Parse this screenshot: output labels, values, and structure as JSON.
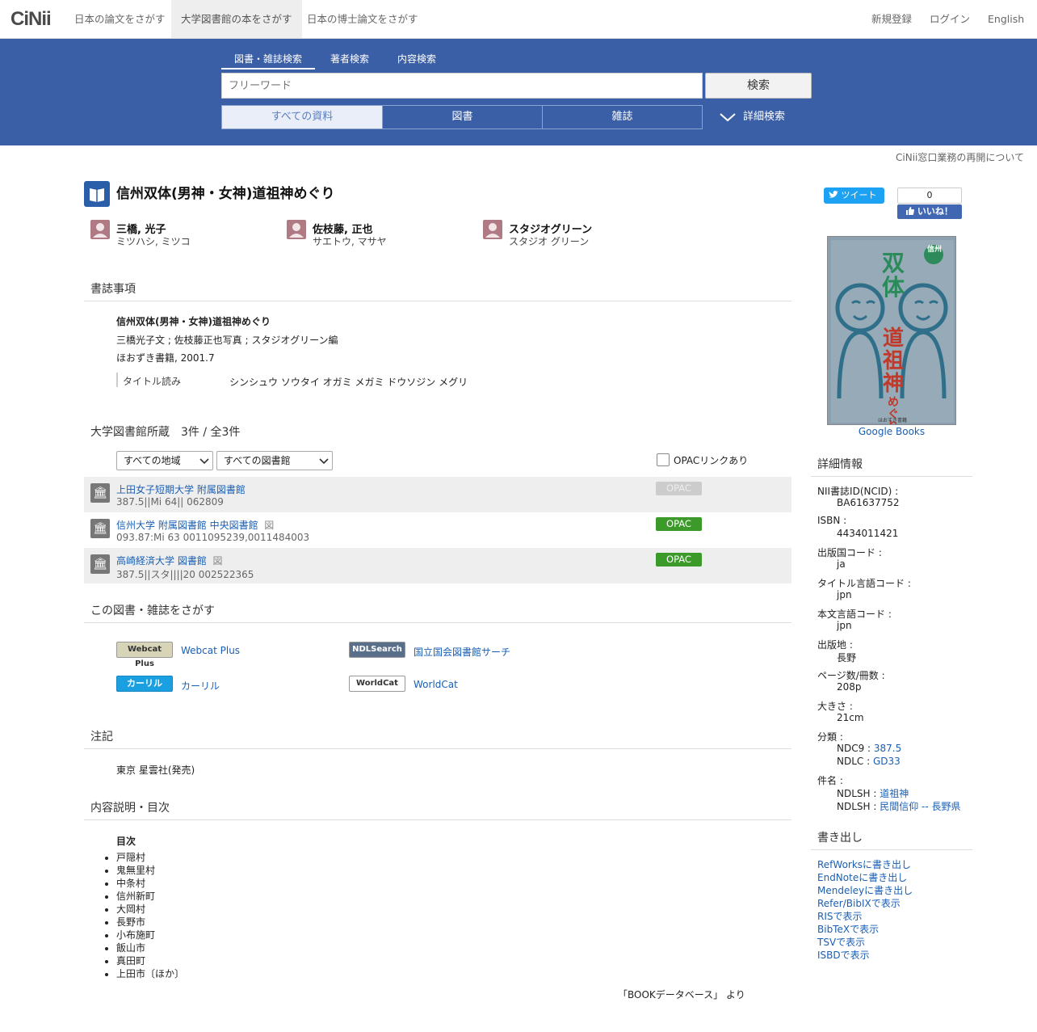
{
  "header": {
    "logo": "CiNii",
    "tabs": [
      "日本の論文をさがす",
      "大学図書館の本をさがす",
      "日本の博士論文をさがす"
    ],
    "active_tab": 1,
    "links": [
      "新規登録",
      "ログイン",
      "English"
    ]
  },
  "search": {
    "tabs": [
      "図書・雑誌検索",
      "著者検索",
      "内容検索"
    ],
    "placeholder": "フリーワード",
    "button": "検索",
    "material_tabs": [
      "すべての資料",
      "図書",
      "雑誌"
    ],
    "advanced": "詳細検索"
  },
  "notice": "CiNii窓口業務の再開について",
  "book": {
    "title": "信州双体(男神・女神)道祖神めぐり",
    "authors": [
      {
        "name": "三橋, 光子",
        "kana": "ミツハシ, ミツコ"
      },
      {
        "name": "佐枝藤, 正也",
        "kana": "サエトウ, マサヤ"
      },
      {
        "name": "スタジオグリーン",
        "kana": "スタジオ グリーン"
      }
    ]
  },
  "bibliography": {
    "heading": "書誌事項",
    "title": "信州双体(男神・女神)道祖神めぐり",
    "responsibility": "三橋光子文 ; 佐枝藤正也写真 ; スタジオグリーン編",
    "publisher": "ほおずき書籍, 2001.7",
    "reading_label": "タイトル読み",
    "reading_value": "シンシュウ ソウタイ オガミ メガミ ドウソジン メグリ"
  },
  "holdings": {
    "heading": "大学図書館所蔵　3件 / 全3件",
    "region_select": "すべての地域",
    "library_select": "すべての図書館",
    "opac_filter": "OPACリンクあり",
    "items": [
      {
        "library": "上田女子短期大学 附属図書館",
        "call": "387.5||Mi 64||  062809",
        "opac": "OPAC",
        "opac_active": false,
        "mark": ""
      },
      {
        "library": "信州大学 附属図書館 中央図書館",
        "call": "093.87:Mi 63  0011095239,0011484003",
        "opac": "OPAC",
        "opac_active": true,
        "mark": "図"
      },
      {
        "library": "高崎経済大学 図書館",
        "call": "387.5||スタ||||20  002522365",
        "opac": "OPAC",
        "opac_active": true,
        "mark": "図"
      }
    ]
  },
  "find": {
    "heading": "この図書・雑誌をさがす",
    "links": [
      {
        "logo": "Webcat Plus",
        "label": "Webcat Plus"
      },
      {
        "logo": "NDLSearch",
        "label": "国立国会図書館サーチ"
      },
      {
        "logo": "カーリル",
        "label": "カーリル"
      },
      {
        "logo": "WorldCat",
        "label": "WorldCat"
      }
    ]
  },
  "notes": {
    "heading": "注記",
    "text": "東京 星雲社(発売)"
  },
  "contents": {
    "heading": "内容説明・目次",
    "subheading": "目次",
    "items": [
      "戸隠村",
      "鬼無里村",
      "中条村",
      "信州新町",
      "大岡村",
      "長野市",
      "小布施町",
      "飯山市",
      "真田町",
      "上田市〔ほか〕"
    ],
    "source": "「BOOKデータベース」 より"
  },
  "social": {
    "tweet": "ツイート",
    "like_count": "0",
    "like": "いいね！"
  },
  "cover": {
    "source": "Google Books",
    "title_top": "信州",
    "title_mid": "双体",
    "title_sub": "道祖神",
    "title_end": "めぐり",
    "publisher": "ほおずき書籍"
  },
  "details": {
    "heading": "詳細情報",
    "ncid_label": "NII書誌ID(NCID) :",
    "ncid": "BA61637752",
    "isbn_label": "ISBN :",
    "isbn": "4434011421",
    "country_label": "出版国コード :",
    "country": "ja",
    "title_lang_label": "タイトル言語コード :",
    "title_lang": "jpn",
    "text_lang_label": "本文言語コード :",
    "text_lang": "jpn",
    "place_label": "出版地 :",
    "place": "長野",
    "pages_label": "ページ数/冊数 :",
    "pages": "208p",
    "size_label": "大きさ :",
    "size": "21cm",
    "class_label": "分類 :",
    "ndc9_prefix": "NDC9 : ",
    "ndc9": "387.5",
    "ndlc_prefix": "NDLC : ",
    "ndlc": "GD33",
    "subject_label": "件名 :",
    "ndlsh_prefix": "NDLSH : ",
    "subject1": "道祖神",
    "subject2": "民間信仰 -- 長野県"
  },
  "export": {
    "heading": "書き出し",
    "links": [
      "RefWorksに書き出し",
      "EndNoteに書き出し",
      "Mendeleyに書き出し",
      "Refer/BibIXで表示",
      "RISで表示",
      "BibTeXで表示",
      "TSVで表示",
      "ISBDで表示"
    ]
  }
}
